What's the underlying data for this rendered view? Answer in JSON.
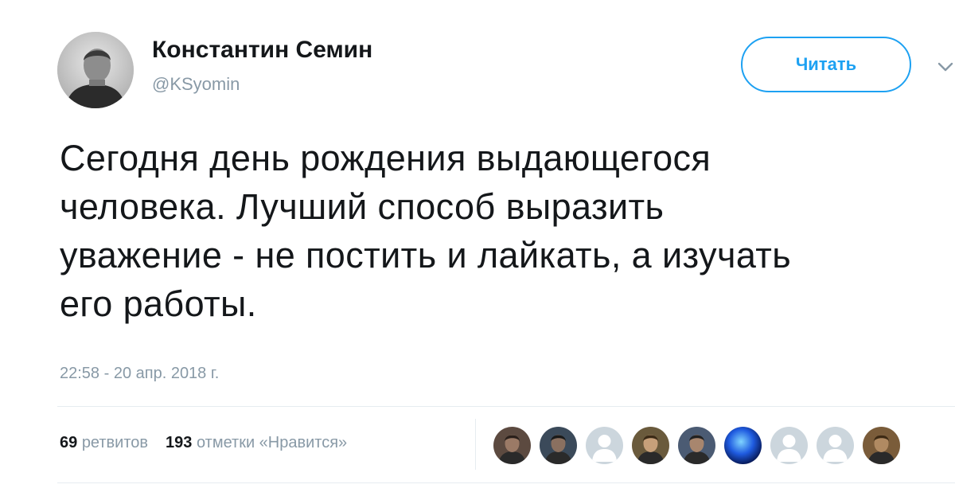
{
  "tweet": {
    "author": {
      "display_name": "Константин Семин",
      "handle": "@KSyomin"
    },
    "follow_button_label": "Читать",
    "text_lines": [
      "Сегодня день рождения выдающегося",
      "человека. Лучший способ выразить",
      "уважение - не постить и лайкать, а изучать",
      "его работы."
    ],
    "timestamp": "22:58 - 20 апр. 2018 г.",
    "stats": {
      "retweets_count": "69",
      "retweets_label": "ретвитов",
      "likes_count": "193",
      "likes_label": "отметки «Нравится»"
    },
    "likers": [
      {
        "icon": "user-photo"
      },
      {
        "icon": "user-photo"
      },
      {
        "icon": "default-user-icon"
      },
      {
        "icon": "user-photo"
      },
      {
        "icon": "user-photo"
      },
      {
        "icon": "user-photo"
      },
      {
        "icon": "default-user-icon"
      },
      {
        "icon": "default-user-icon"
      },
      {
        "icon": "user-photo"
      }
    ]
  },
  "colors": {
    "accent": "#1da1f2",
    "text": "#14171a",
    "secondary_text": "#8899a6",
    "divider": "#e6ecf0"
  }
}
